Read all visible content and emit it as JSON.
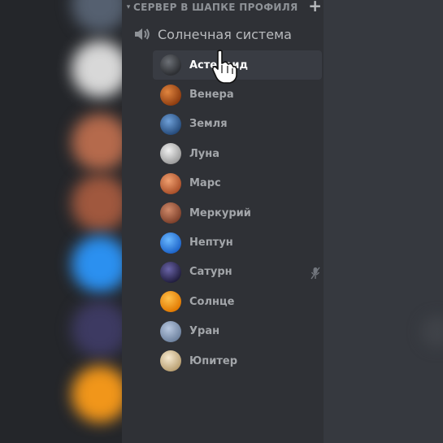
{
  "category": {
    "label": "СЕРВЕР В ШАПКЕ ПРОФИЛЯ",
    "collapse_icon": "chevron-down-icon",
    "add_icon": "plus-icon"
  },
  "voice_channel": {
    "name": "Солнечная система",
    "icon": "speaker-icon"
  },
  "members": [
    {
      "name": "Астероид",
      "avatar_color": "#4a4d52",
      "active": true
    },
    {
      "name": "Венера",
      "avatar_color": "#b5541a"
    },
    {
      "name": "Земля",
      "avatar_color": "#3b6ea8"
    },
    {
      "name": "Луна",
      "avatar_color": "#cfcfcf"
    },
    {
      "name": "Марс",
      "avatar_color": "#d07a4a"
    },
    {
      "name": "Меркурий",
      "avatar_color": "#b0664a"
    },
    {
      "name": "Нептун",
      "avatar_color": "#2f8cf0",
      "muted": false
    },
    {
      "name": "Сатурн",
      "avatar_color": "#3a3566",
      "muted": true
    },
    {
      "name": "Солнце",
      "avatar_color": "#f29a1b"
    },
    {
      "name": "Уран",
      "avatar_color": "#8ea3c3"
    },
    {
      "name": "Юпитер",
      "avatar_color": "#e2cfa6"
    }
  ],
  "colors": {
    "background": "#2f3136",
    "server_strip": "#24262a",
    "active_row": "#393c43",
    "text_muted": "#a3a6aa",
    "text_active": "#ffffff"
  }
}
